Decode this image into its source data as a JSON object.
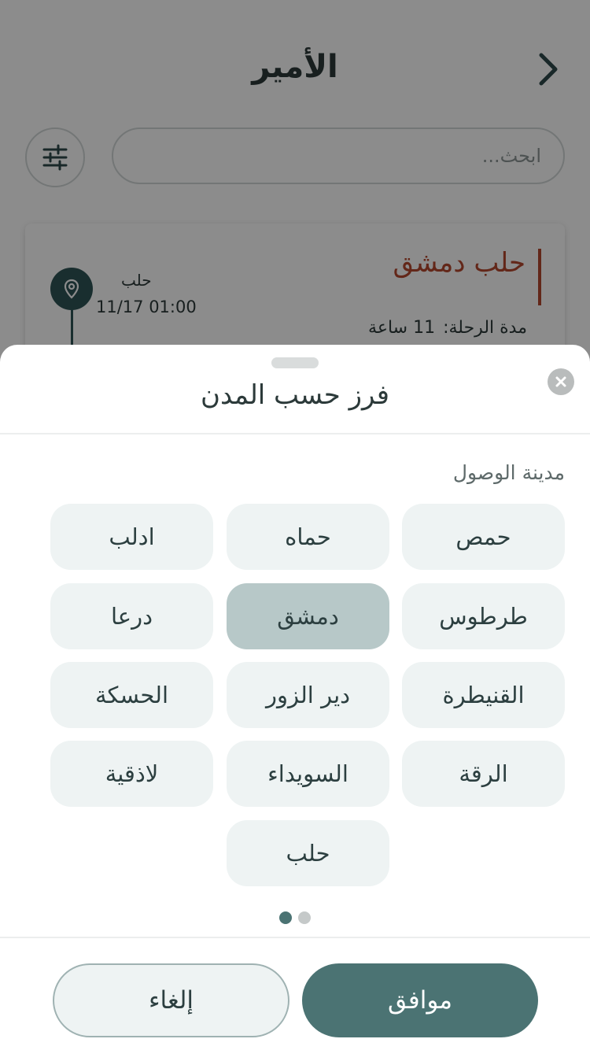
{
  "header": {
    "title": "الأمير"
  },
  "search": {
    "placeholder": "ابحث..."
  },
  "trip": {
    "route": "حلب دمشق",
    "duration_label": "مدة الرحلة:",
    "duration_value": "11 ساعة",
    "stop_city": "حلب",
    "stop_time": "11/17 01:00"
  },
  "sheet": {
    "title": "فرز حسب المدن",
    "section_label": "مدينة الوصول",
    "cities": [
      "حمص",
      "حماه",
      "ادلب",
      "طرطوس",
      "دمشق",
      "درعا",
      "القنيطرة",
      "دير الزور",
      "الحسكة",
      "الرقة",
      "السويداء",
      "لاذقية",
      "حلب"
    ],
    "selected_city": "دمشق",
    "pager": {
      "total": 2,
      "active": 1
    },
    "ok_label": "موافق",
    "cancel_label": "إلغاء"
  },
  "icons": [
    "back-arrow-icon",
    "filter-icon",
    "location-pin-icon",
    "close-icon"
  ],
  "colors": {
    "primary": "#4b7373",
    "route_accent": "#b5482e",
    "chip_bg": "#eef3f3",
    "chip_selected_bg": "#b7c8c8"
  }
}
